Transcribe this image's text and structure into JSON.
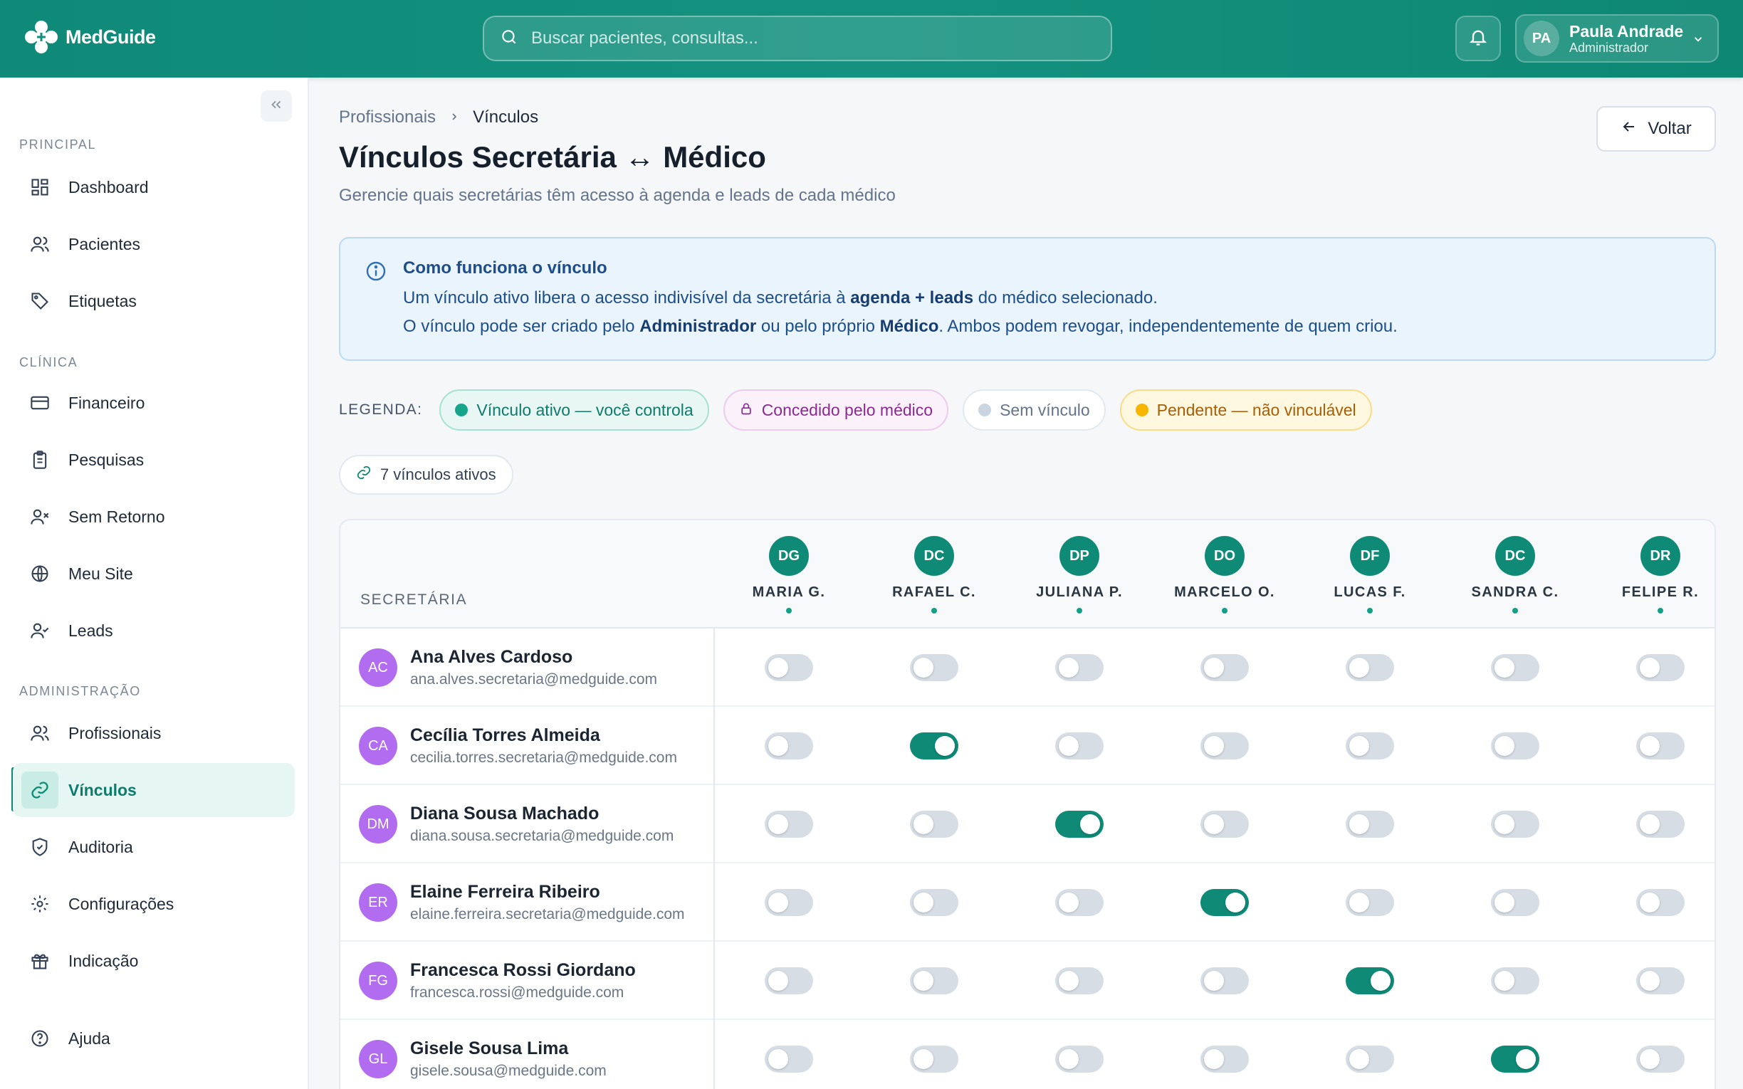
{
  "app": {
    "brand": "MedGuide",
    "search_placeholder": "Buscar pacientes, consultas...",
    "user": {
      "initials": "PA",
      "name": "Paula Andrade",
      "role": "Administrador"
    }
  },
  "sidebar": {
    "sections": [
      {
        "label": "PRINCIPAL",
        "items": [
          {
            "label": "Dashboard",
            "icon": "grid-icon"
          },
          {
            "label": "Pacientes",
            "icon": "users-icon"
          },
          {
            "label": "Etiquetas",
            "icon": "tag-icon"
          }
        ]
      },
      {
        "label": "CLÍNICA",
        "items": [
          {
            "label": "Financeiro",
            "icon": "credit-card-icon"
          },
          {
            "label": "Pesquisas",
            "icon": "clipboard-icon"
          },
          {
            "label": "Sem Retorno",
            "icon": "user-x-icon"
          },
          {
            "label": "Meu Site",
            "icon": "globe-icon"
          },
          {
            "label": "Leads",
            "icon": "user-check-icon"
          }
        ]
      },
      {
        "label": "ADMINISTRAÇÃO",
        "items": [
          {
            "label": "Profissionais",
            "icon": "users-icon"
          },
          {
            "label": "Vínculos",
            "icon": "link-icon",
            "active": true
          },
          {
            "label": "Auditoria",
            "icon": "shield-icon"
          },
          {
            "label": "Configurações",
            "icon": "gear-icon"
          },
          {
            "label": "Indicação",
            "icon": "gift-icon"
          }
        ]
      }
    ],
    "help": "Ajuda"
  },
  "page": {
    "breadcrumb": [
      "Profissionais",
      "Vínculos"
    ],
    "title": "Vínculos Secretária ↔ Médico",
    "subtitle": "Gerencie quais secretárias têm acesso à agenda e leads de cada médico",
    "back_label": "Voltar"
  },
  "info": {
    "title": "Como funciona o vínculo",
    "line1": {
      "a": "Um vínculo ativo libera o acesso indivisível da secretária à ",
      "b": "agenda + leads",
      "c": " do médico selecionado."
    },
    "line2": {
      "a": "O vínculo pode ser criado pelo ",
      "b": "Administrador",
      "c": " ou pelo próprio ",
      "d": "Médico",
      "e": ". Ambos podem revogar, independentemente de quem criou."
    }
  },
  "legend": {
    "label": "LEGENDA:",
    "items": [
      "Vínculo ativo — você controla",
      "Concedido pelo médico",
      "Sem vínculo",
      "Pendente — não vinculável"
    ]
  },
  "active_count": "7 vínculos ativos",
  "table": {
    "secretary_header": "SECRETÁRIA",
    "doctors": [
      {
        "initials": "DG",
        "name": "MARIA G."
      },
      {
        "initials": "DC",
        "name": "RAFAEL C."
      },
      {
        "initials": "DP",
        "name": "JULIANA P."
      },
      {
        "initials": "DO",
        "name": "MARCELO O."
      },
      {
        "initials": "DF",
        "name": "LUCAS F."
      },
      {
        "initials": "DC",
        "name": "SANDRA C."
      },
      {
        "initials": "DR",
        "name": "FELIPE R."
      }
    ],
    "rows": [
      {
        "initials": "AC",
        "name": "Ana Alves Cardoso",
        "email": "ana.alves.secretaria@medguide.com",
        "links": [
          false,
          false,
          false,
          false,
          false,
          false,
          false
        ]
      },
      {
        "initials": "CA",
        "name": "Cecília Torres Almeida",
        "email": "cecilia.torres.secretaria@medguide.com",
        "links": [
          false,
          true,
          false,
          false,
          false,
          false,
          false
        ]
      },
      {
        "initials": "DM",
        "name": "Diana Sousa Machado",
        "email": "diana.sousa.secretaria@medguide.com",
        "links": [
          false,
          false,
          true,
          false,
          false,
          false,
          false
        ]
      },
      {
        "initials": "ER",
        "name": "Elaine Ferreira Ribeiro",
        "email": "elaine.ferreira.secretaria@medguide.com",
        "links": [
          false,
          false,
          false,
          true,
          false,
          false,
          false
        ]
      },
      {
        "initials": "FG",
        "name": "Francesca Rossi Giordano",
        "email": "francesca.rossi@medguide.com",
        "links": [
          false,
          false,
          false,
          false,
          true,
          false,
          false
        ]
      },
      {
        "initials": "GL",
        "name": "Gisele Sousa Lima",
        "email": "gisele.sousa@medguide.com",
        "links": [
          false,
          false,
          false,
          false,
          false,
          true,
          false
        ]
      }
    ]
  },
  "colors": {
    "brand": "#0f8a77",
    "accent_bg": "#e6f6f2",
    "avatar_secretary": "#b26cf0"
  }
}
